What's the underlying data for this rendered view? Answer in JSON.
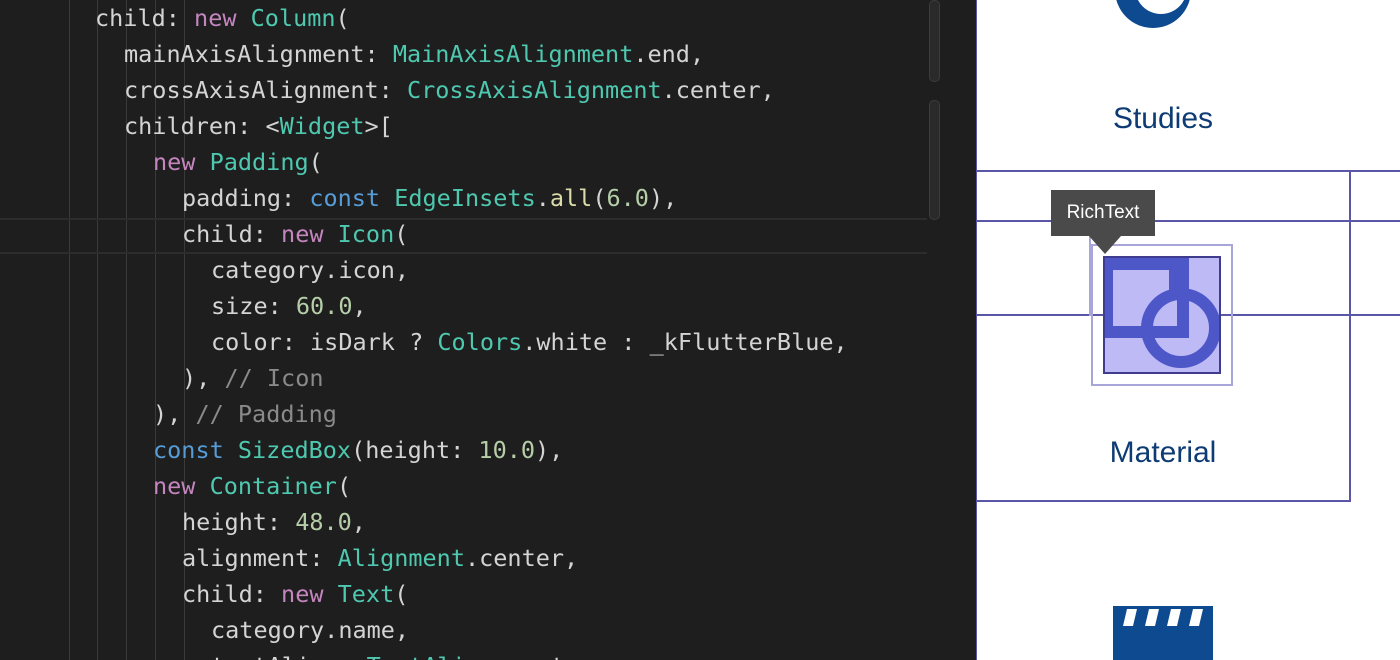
{
  "editor": {
    "lines": [
      [
        [
          "plain",
          "child: "
        ],
        [
          "kw-pink",
          "new "
        ],
        [
          "type",
          "Column"
        ],
        [
          "plain",
          "("
        ]
      ],
      [
        [
          "plain",
          "mainAxisAlignment: "
        ],
        [
          "type",
          "MainAxisAlignment"
        ],
        [
          "plain",
          ".end,"
        ]
      ],
      [
        [
          "plain",
          "crossAxisAlignment: "
        ],
        [
          "type",
          "CrossAxisAlignment"
        ],
        [
          "plain",
          ".center,"
        ]
      ],
      [
        [
          "plain",
          "children: <"
        ],
        [
          "type",
          "Widget"
        ],
        [
          "plain",
          ">["
        ]
      ],
      [
        [
          "kw-pink",
          "new "
        ],
        [
          "type",
          "Padding"
        ],
        [
          "plain",
          "("
        ]
      ],
      [
        [
          "plain",
          "padding: "
        ],
        [
          "kw-blue",
          "const "
        ],
        [
          "type",
          "EdgeInsets"
        ],
        [
          "plain",
          "."
        ],
        [
          "fn",
          "all"
        ],
        [
          "plain",
          "("
        ],
        [
          "num",
          "6.0"
        ],
        [
          "plain",
          "),"
        ]
      ],
      [
        [
          "plain",
          "child: "
        ],
        [
          "kw-pink",
          "new "
        ],
        [
          "type",
          "Icon"
        ],
        [
          "plain",
          "("
        ]
      ],
      [
        [
          "plain",
          "category.icon,"
        ]
      ],
      [
        [
          "plain",
          "size: "
        ],
        [
          "num",
          "60.0"
        ],
        [
          "plain",
          ","
        ]
      ],
      [
        [
          "plain",
          "color: isDark ? "
        ],
        [
          "type",
          "Colors"
        ],
        [
          "plain",
          ".white : _kFlutterBlue,"
        ]
      ],
      [
        [
          "plain",
          "), "
        ],
        [
          "cmt",
          "// Icon"
        ]
      ],
      [
        [
          "plain",
          "), "
        ],
        [
          "cmt",
          "// Padding"
        ]
      ],
      [
        [
          "kw-blue",
          "const "
        ],
        [
          "type",
          "SizedBox"
        ],
        [
          "plain",
          "(height: "
        ],
        [
          "num",
          "10.0"
        ],
        [
          "plain",
          "),"
        ]
      ],
      [
        [
          "kw-pink",
          "new "
        ],
        [
          "type",
          "Container"
        ],
        [
          "plain",
          "("
        ]
      ],
      [
        [
          "plain",
          "height: "
        ],
        [
          "num",
          "48.0"
        ],
        [
          "plain",
          ","
        ]
      ],
      [
        [
          "plain",
          "alignment: "
        ],
        [
          "type",
          "Alignment"
        ],
        [
          "plain",
          ".center,"
        ]
      ],
      [
        [
          "plain",
          "child: "
        ],
        [
          "kw-pink",
          "new "
        ],
        [
          "type",
          "Text"
        ],
        [
          "plain",
          "("
        ]
      ],
      [
        [
          "plain",
          "category.name,"
        ]
      ],
      [
        [
          "plain",
          "textAlign: "
        ],
        [
          "type",
          "TextAlign"
        ],
        [
          "plain",
          ".center,"
        ]
      ]
    ]
  },
  "preview": {
    "studies_label": "Studies",
    "material_label": "Material",
    "tooltip": "RichText",
    "colors": {
      "label": "#0d3b73",
      "icon_blue": "#0d4a8f",
      "debug_border": "#5b56a6",
      "highlight_fill": "#bdbaf6"
    },
    "icons": [
      "studies-icon",
      "material-icon",
      "clapperboard-icon"
    ]
  }
}
